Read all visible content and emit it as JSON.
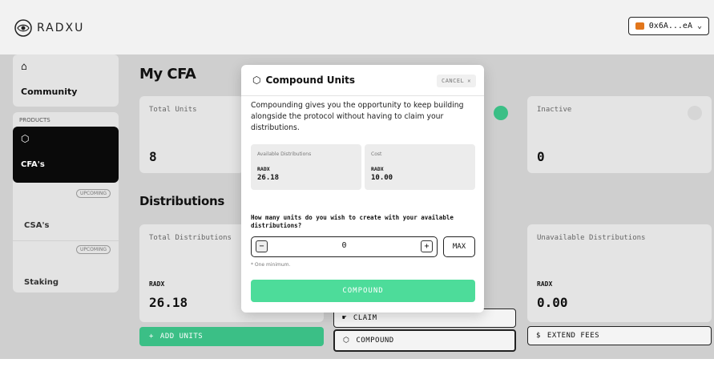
{
  "app": {
    "name": "RADXU"
  },
  "wallet": {
    "address": "0x6A...eA",
    "chevron": "chevron-down-icon"
  },
  "sidebar": {
    "community": "Community",
    "products_label": "PRODUCTS",
    "items": [
      {
        "label": "CFA's"
      },
      {
        "label": "CSA's",
        "badge": "UPCOMING"
      },
      {
        "label": "Staking",
        "badge": "UPCOMING"
      }
    ]
  },
  "my_cfa": {
    "title": "My CFA",
    "total_units": {
      "label": "Total Units",
      "value": "8"
    },
    "inactive": {
      "label": "Inactive",
      "value": "0"
    }
  },
  "distributions": {
    "title": "Distributions",
    "total": {
      "label": "Total Distributions",
      "token": "RADX",
      "value": "26.18"
    },
    "unavailable": {
      "label": "Unavailable Distributions",
      "token": "RADX",
      "value": "0.00"
    },
    "buttons": {
      "add_units": "ADD UNITS",
      "claim": "CLAIM",
      "compound": "COMPOUND",
      "extend_fees": "EXTEND FEES"
    }
  },
  "modal": {
    "title": "Compound Units",
    "cancel": "CANCEL",
    "description": "Compounding gives you the opportunity to keep building alongside the protocol without having to claim your distributions.",
    "available": {
      "label": "Available Distributions",
      "token": "RADX",
      "value": "26.18"
    },
    "cost": {
      "label": "Cost",
      "token": "RADX",
      "value": "10.00"
    },
    "question": "How many units do you wish to create with your available distributions?",
    "quantity": "0",
    "max": "MAX",
    "minimum_note": "* One minimum.",
    "submit": "COMPOUND"
  },
  "colors": {
    "accent": "#3bbf86",
    "compound_green": "#4ddc9a",
    "active_dot": "#3bbf86"
  }
}
